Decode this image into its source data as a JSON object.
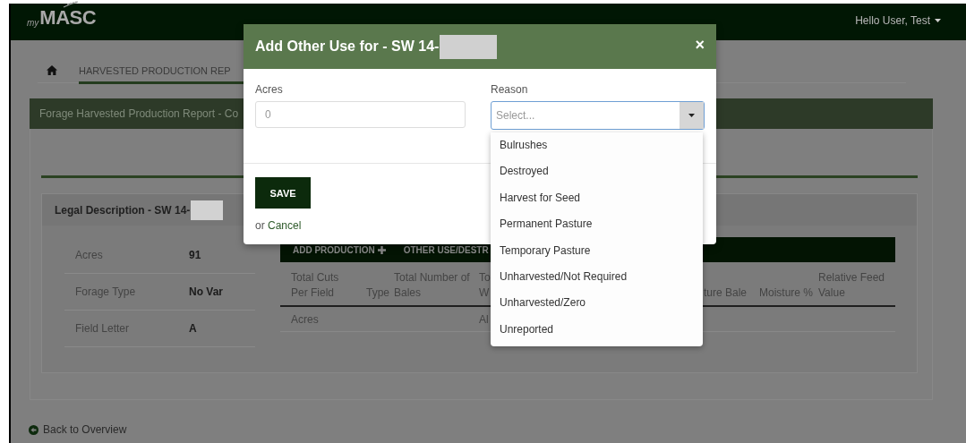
{
  "header": {
    "logo_prefix": "my",
    "logo": "MASC",
    "user_menu": "Hello User, Test"
  },
  "breadcrumb": {
    "tab": "HARVESTED PRODUCTION REP"
  },
  "report": {
    "title": "Forage Harvested Production Report - Co",
    "legal_description": {
      "title": "Legal Description - SW 14-",
      "fields": [
        {
          "label": "Acres",
          "value": "91"
        },
        {
          "label": "Forage Type",
          "value": "No Var"
        },
        {
          "label": "Field Letter",
          "value": "A"
        }
      ]
    },
    "toolbar": [
      "ADD PRODUCTION",
      "OTHER USE/DESTR"
    ],
    "table": {
      "columns": [
        "Total Cuts Per Field",
        "Type",
        "Total Number of Bales",
        "To W",
        "ture Bale",
        "Moisture %",
        "Relative Feed Value"
      ],
      "rows": [
        [
          "Acres",
          "",
          "",
          "Al"
        ]
      ]
    }
  },
  "back_link": "Back to Overview",
  "modal": {
    "title": "Add Other Use for - SW 14-",
    "close": "×",
    "acres": {
      "label": "Acres",
      "placeholder": "0"
    },
    "reason": {
      "label": "Reason",
      "placeholder": "Select...",
      "options": [
        "Bulrushes",
        "Destroyed",
        "Harvest for Seed",
        "Permanent Pasture",
        "Temporary Pasture",
        "Unharvested/Not Required",
        "Unharvested/Zero",
        "Unreported"
      ]
    },
    "save": "SAVE",
    "cancel_prefix": "or",
    "cancel": "Cancel"
  }
}
